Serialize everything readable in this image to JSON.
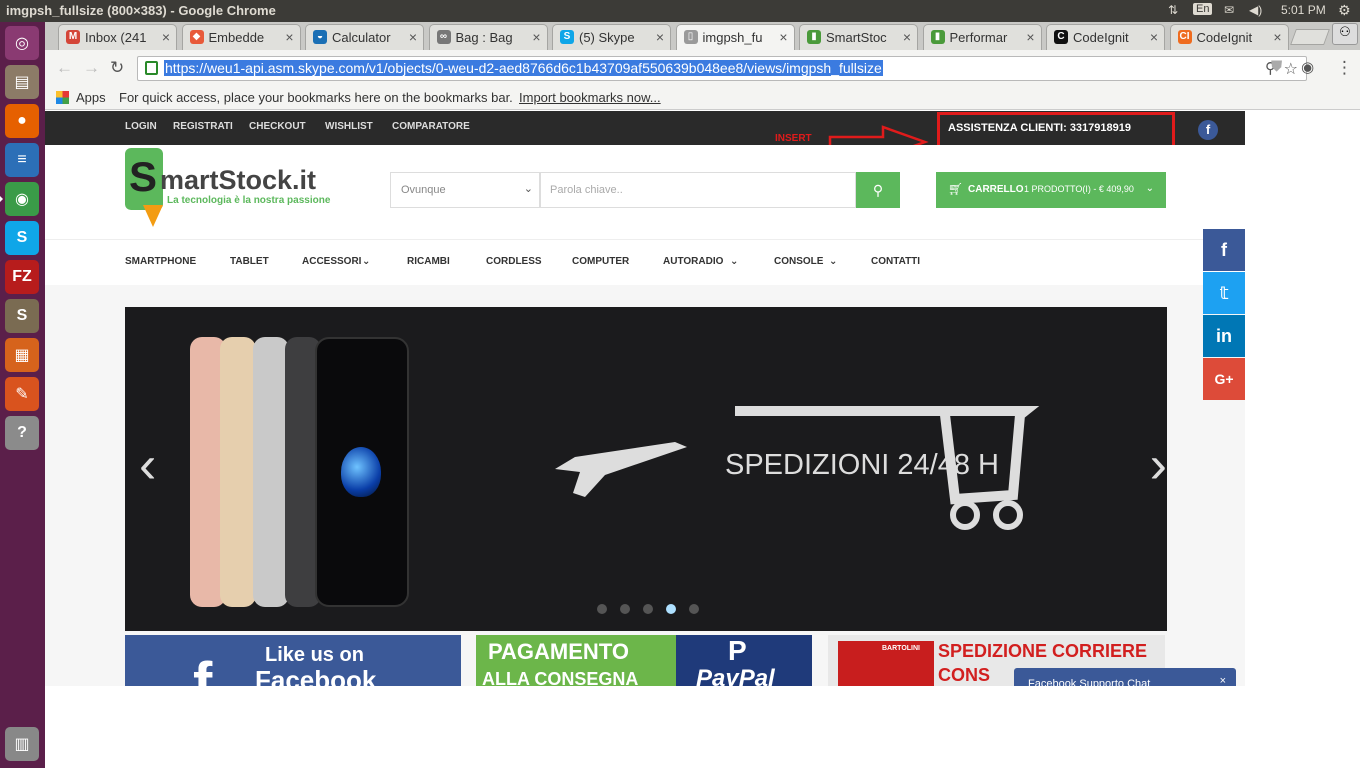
{
  "window": {
    "title": "imgpsh_fullsize (800×383) - Google Chrome",
    "lang": "En",
    "clock": "5:01 PM"
  },
  "launcher": [
    {
      "name": "ubuntu-dash-icon",
      "glyph": "◎",
      "color": "#8a3a72"
    },
    {
      "name": "files-icon",
      "glyph": "▤",
      "color": "#8c7b67"
    },
    {
      "name": "firefox-icon",
      "glyph": "●",
      "color": "#e66000"
    },
    {
      "name": "writer-icon",
      "glyph": "≡",
      "color": "#2c6fb7"
    },
    {
      "name": "chrome-icon",
      "glyph": "◉",
      "color": "#3a9b48"
    },
    {
      "name": "skype-icon",
      "glyph": "S",
      "color": "#0fa6e8"
    },
    {
      "name": "filezilla-icon",
      "glyph": "FZ",
      "color": "#b71c1c"
    },
    {
      "name": "sublime-icon",
      "glyph": "S",
      "color": "#7a6b52"
    },
    {
      "name": "impress-icon",
      "glyph": "▦",
      "color": "#d6631c"
    },
    {
      "name": "settings-icon",
      "glyph": "✎",
      "color": "#d9531e"
    },
    {
      "name": "help-icon",
      "glyph": "?",
      "color": "#8b8b8b"
    }
  ],
  "tabs": [
    {
      "label": "Inbox (241",
      "icon": "M",
      "color": "#d44638"
    },
    {
      "label": "Embedde",
      "icon": "◆",
      "color": "#e85a3a"
    },
    {
      "label": "Calculator",
      "icon": "◒",
      "color": "#1a6fb5"
    },
    {
      "label": "Bag : Bag",
      "icon": "∞",
      "color": "#777777"
    },
    {
      "label": "(5) Skype",
      "icon": "S",
      "color": "#0fa6e8"
    },
    {
      "label": "imgpsh_fu",
      "icon": "▯",
      "color": "#9a9a9a"
    },
    {
      "label": "SmartStoc",
      "icon": "▮",
      "color": "#4a9a3a"
    },
    {
      "label": "Performar",
      "icon": "▮",
      "color": "#4a9a3a"
    },
    {
      "label": "CodeIgnit",
      "icon": "C",
      "color": "#111111"
    },
    {
      "label": "CodeIgnit",
      "icon": "CI",
      "color": "#ef6c1f"
    }
  ],
  "active_tab_index": 5,
  "address": {
    "url": "https://weu1-api.asm.skype.com/v1/objects/0-weu-d2-aed8766d6c1b43709af550639b048ee8/views/imgpsh_fullsize"
  },
  "bookmarks": {
    "apps": "Apps",
    "hint": "For quick access, place your bookmarks here on the bookmarks bar.",
    "import": "Import bookmarks now..."
  },
  "site": {
    "top_links": [
      "LOGIN",
      "REGISTRATI",
      "CHECKOUT",
      "WISHLIST",
      "COMPARATORE"
    ],
    "insert_label": "INSERT",
    "assistance": "ASSISTENZA CLIENTI: 3317918919",
    "logo_text": "martStock.it",
    "logo_s": "S",
    "tagline": "La tecnologia è la nostra passione",
    "search_scope": "Ovunque",
    "search_placeholder": "Parola chiave..",
    "cart": "CARRELLO",
    "cart_detail": "1 PRODOTTO(I) - € 409,90",
    "nav": [
      "SMARTPHONE",
      "TABLET",
      "ACCESSORI",
      "RICAMBI",
      "CORDLESS",
      "COMPUTER",
      "AUTORADIO",
      "CONSOLE",
      "CONTATTI"
    ],
    "slide_text": "SPEDIZIONI 24/48 H",
    "slider_active_dot": 3,
    "banner1_line1": "Like us on",
    "banner1_line2": "Facebook",
    "banner2_line1": "PAGAMENTO",
    "banner2_line2": "ALLA CONSEGNA",
    "banner2_brand": "PayPal",
    "banner3_brand": "BARTOLINI",
    "banner3_line1": "SPEDIZIONE CORRIERE",
    "banner3_line2": "CONS",
    "chat_label": "Facebook Supporto Chat"
  },
  "colors": {
    "green": "#5cb85c",
    "red": "#e01b1b",
    "facebook": "#3b5998",
    "twitter": "#1da1f2",
    "linkedin": "#0077b5",
    "gplus": "#dd4b39"
  }
}
